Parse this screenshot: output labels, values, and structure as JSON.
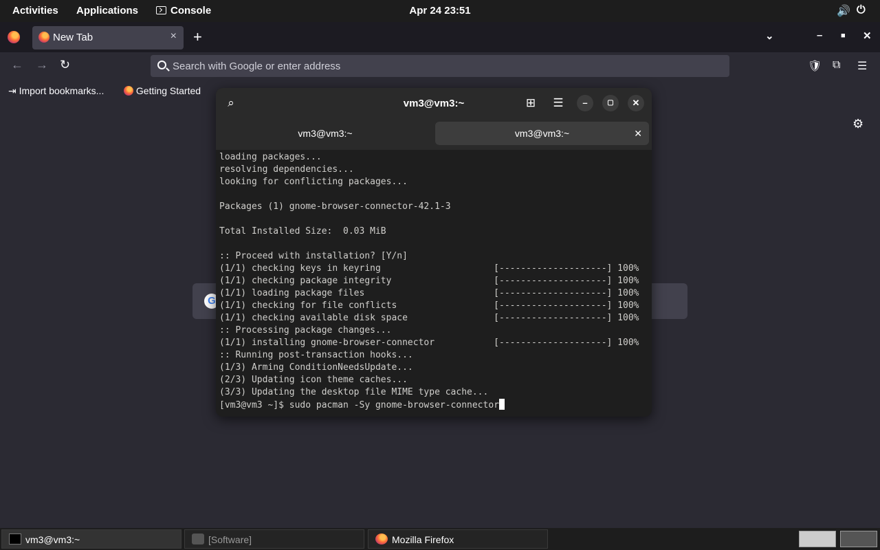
{
  "topbar": {
    "activities": "Activities",
    "applications": "Applications",
    "console": "Console",
    "datetime": "Apr 24  23:51"
  },
  "browser": {
    "tab_title": "New Tab",
    "tab_close": "×",
    "newtab_label": "+",
    "address_placeholder": "Search with Google or enter address",
    "bookmarks": {
      "import": "Import bookmarks...",
      "getting_started": "Getting Started"
    }
  },
  "terminal": {
    "title": "vm3@vm3:~",
    "tabs": [
      {
        "label": "vm3@vm3:~"
      },
      {
        "label": "vm3@vm3:~"
      }
    ],
    "lines": [
      "loading packages...",
      "resolving dependencies...",
      "looking for conflicting packages...",
      "",
      "Packages (1) gnome-browser-connector-42.1-3",
      "",
      "Total Installed Size:  0.03 MiB",
      "",
      ":: Proceed with installation? [Y/n]",
      "(1/1) checking keys in keyring                     [--------------------] 100%",
      "(1/1) checking package integrity                   [--------------------] 100%",
      "(1/1) loading package files                        [--------------------] 100%",
      "(1/1) checking for file conflicts                  [--------------------] 100%",
      "(1/1) checking available disk space                [--------------------] 100%",
      ":: Processing package changes...",
      "(1/1) installing gnome-browser-connector           [--------------------] 100%",
      ":: Running post-transaction hooks...",
      "(1/3) Arming ConditionNeedsUpdate...",
      "(2/3) Updating icon theme caches...",
      "(3/3) Updating the desktop file MIME type cache..."
    ],
    "prompt": "[vm3@vm3 ~]$ sudo pacman -Sy gnome-browser-connector"
  },
  "taskbar": {
    "items": [
      {
        "label": "vm3@vm3:~"
      },
      {
        "label": "[Software]"
      },
      {
        "label": "Mozilla Firefox"
      }
    ]
  }
}
